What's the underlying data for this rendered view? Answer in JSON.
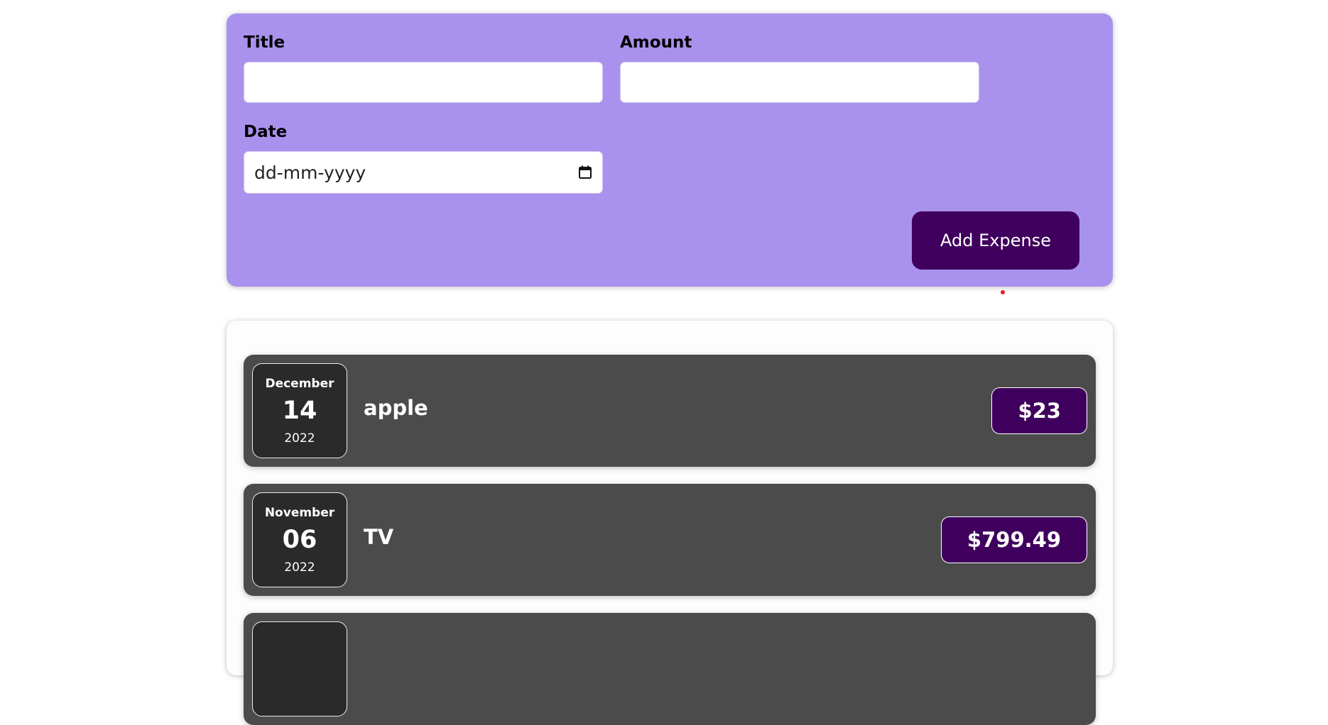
{
  "form": {
    "title_label": "Title",
    "title_value": "",
    "amount_label": "Amount",
    "amount_value": "",
    "date_label": "Date",
    "date_placeholder": "dd-mm-yyyy",
    "submit_label": "Add Expense"
  },
  "icons": {
    "date_picker": "calendar-icon"
  },
  "colors": {
    "form_background": "#a892ee",
    "button_background": "#40005d",
    "item_background": "#4b4b4b",
    "date_box_background": "#2a2a2a",
    "price_background": "#40005d"
  },
  "expenses": [
    {
      "month": "December",
      "day": "14",
      "year": "2022",
      "title": "apple",
      "amount": "$23"
    },
    {
      "month": "November",
      "day": "06",
      "year": "2022",
      "title": "TV",
      "amount": "$799.49"
    },
    {
      "month": "",
      "day": "",
      "year": "",
      "title": "",
      "amount": ""
    }
  ]
}
